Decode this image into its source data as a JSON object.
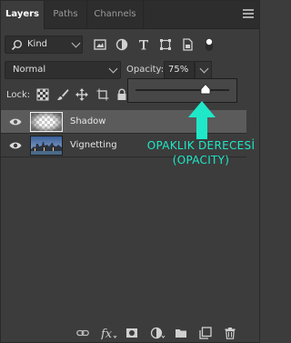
{
  "tabs": [
    {
      "label": "Layers",
      "active": true
    },
    {
      "label": "Paths",
      "active": false
    },
    {
      "label": "Channels",
      "active": false
    }
  ],
  "filter": {
    "kind_label": "Kind",
    "icons": [
      "pixel-filter-icon",
      "adjustment-filter-icon",
      "type-filter-icon",
      "shape-filter-icon",
      "smart-object-filter-icon",
      "filter-toggle-icon"
    ]
  },
  "blend": {
    "mode": "Normal",
    "opacity_label": "Opacity:",
    "opacity_value": "75%",
    "opacity_fraction": 0.75
  },
  "lock": {
    "label": "Lock:",
    "icons": [
      "lock-transparent-pixels-icon",
      "lock-image-pixels-icon",
      "lock-position-icon",
      "lock-artboard-icon",
      "lock-all-icon"
    ]
  },
  "layers": [
    {
      "name": "Shadow",
      "selected": true,
      "visible": true
    },
    {
      "name": "Vignetting",
      "selected": false,
      "visible": true
    }
  ],
  "annotation": {
    "line1": "OPAKLIK DERECESİ",
    "line2": "(OPACITY)",
    "color": "#1fe8c8"
  },
  "footer_icons": [
    "link-layers-icon",
    "fx-icon",
    "mask-icon",
    "adjustment-layer-icon",
    "group-folder-icon",
    "new-layer-icon",
    "trash-icon"
  ]
}
